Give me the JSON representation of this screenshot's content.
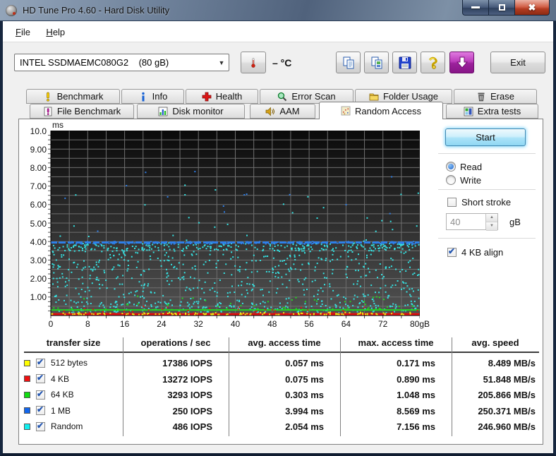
{
  "window": {
    "title": "HD Tune Pro 4.60 - Hard Disk Utility"
  },
  "menu": {
    "items": [
      {
        "label": "File"
      },
      {
        "label": "Help"
      }
    ]
  },
  "toolbar": {
    "drive_select": "INTEL SSDMAEMC080G2    (80 gB)",
    "temperature": "– °C",
    "exit_label": "Exit"
  },
  "tabs": {
    "row1": [
      {
        "label": "Benchmark"
      },
      {
        "label": "Info"
      },
      {
        "label": "Health"
      },
      {
        "label": "Error Scan"
      },
      {
        "label": "Folder Usage"
      },
      {
        "label": "Erase"
      }
    ],
    "row2": [
      {
        "label": "File Benchmark"
      },
      {
        "label": "Disk monitor"
      },
      {
        "label": "AAM"
      },
      {
        "label": "Random Access",
        "active": true
      },
      {
        "label": "Extra tests"
      }
    ]
  },
  "controls": {
    "start": "Start",
    "read": "Read",
    "write": "Write",
    "short_stroke": "Short stroke",
    "short_stroke_value": "40",
    "short_stroke_unit": "gB",
    "align": "4 KB align"
  },
  "chart_data": {
    "type": "scatter",
    "title": "Random Access benchmark — access time (ms) vs disk position (gB)",
    "ylabel_unit": "ms",
    "xlim": [
      0,
      80
    ],
    "ylim": [
      0,
      10
    ],
    "xtick_labels": [
      "0",
      "8",
      "16",
      "24",
      "32",
      "40",
      "48",
      "56",
      "64",
      "72",
      "80gB"
    ],
    "ytick_labels": [
      "10.0",
      "9.00",
      "8.00",
      "7.00",
      "6.00",
      "5.00",
      "4.00",
      "3.00",
      "2.00",
      "1.00"
    ],
    "grid": {
      "on": true,
      "x_step_gb": 4,
      "y_step_ms": 0.5,
      "color": "#6f6f6f"
    },
    "plot_bg": {
      "top": "#0a0a0a",
      "bottom": "#525252"
    },
    "series": [
      {
        "name": "Random",
        "color": "#35e4e4",
        "avg_ms": 2.054,
        "max_ms": 7.156,
        "render": {
          "points": [
            {
              "count": 640,
              "min": 0.18,
              "max": 3.85,
              "bias": 1
            },
            {
              "count": 210,
              "min": 3.45,
              "max": 3.93,
              "bias": 1
            },
            {
              "count": 140,
              "min": 0.05,
              "max": 0.75,
              "bias": 1.4
            },
            {
              "count": 30,
              "min": 4.0,
              "max": 7.16,
              "bias": 1.6
            }
          ]
        }
      },
      {
        "name": "1 MB",
        "color": "#2e7fe8",
        "avg_ms": 3.994,
        "max_ms": 8.569,
        "render": {
          "line_ms": 3.95,
          "line_w": 3,
          "dash": [
            9,
            3
          ],
          "points": [
            {
              "count": 170,
              "min": 3.86,
              "max": 4.0,
              "bias": 1
            },
            {
              "count": 14,
              "min": 4.3,
              "max": 8.57,
              "bias": 1
            }
          ]
        }
      },
      {
        "name": "64 KB",
        "color": "#22d622",
        "avg_ms": 0.303,
        "max_ms": 1.048,
        "render": {
          "line_ms": 0.3,
          "line_w": 2,
          "points": [
            {
              "count": 60,
              "min": 0.32,
              "max": 1.05,
              "bias": 2.6
            }
          ]
        }
      },
      {
        "name": "4 KB",
        "color": "#e01212",
        "avg_ms": 0.075,
        "max_ms": 0.89,
        "render": {
          "line_ms": 0.075,
          "line_w": 3,
          "points": [
            {
              "count": 80,
              "min": 0.09,
              "max": 0.5,
              "bias": 3
            }
          ]
        }
      },
      {
        "name": "512 bytes",
        "color": "#f0ee12",
        "avg_ms": 0.057,
        "max_ms": 0.171,
        "render": {
          "points": [
            {
              "count": 140,
              "min": 0.05,
              "max": 0.18,
              "bias": 2.2
            }
          ]
        }
      }
    ]
  },
  "table": {
    "headers": [
      "transfer size",
      "operations / sec",
      "avg. access time",
      "max. access time",
      "avg. speed"
    ],
    "rows": [
      {
        "label": "512 bytes",
        "color": "#ffff00",
        "checked": true,
        "ops": "17386 IOPS",
        "avg": "0.057 ms",
        "max": "0.171 ms",
        "speed": "8.489 MB/s"
      },
      {
        "label": "4 KB",
        "color": "#ee1111",
        "checked": true,
        "ops": "13272 IOPS",
        "avg": "0.075 ms",
        "max": "0.890 ms",
        "speed": "51.848 MB/s"
      },
      {
        "label": "64 KB",
        "color": "#11dd11",
        "checked": true,
        "ops": "3293 IOPS",
        "avg": "0.303 ms",
        "max": "1.048 ms",
        "speed": "205.866 MB/s"
      },
      {
        "label": "1 MB",
        "color": "#1166ee",
        "checked": true,
        "ops": "250 IOPS",
        "avg": "3.994 ms",
        "max": "8.569 ms",
        "speed": "250.371 MB/s"
      },
      {
        "label": "Random",
        "color": "#11eeee",
        "checked": true,
        "ops": "486 IOPS",
        "avg": "2.054 ms",
        "max": "7.156 ms",
        "speed": "246.960 MB/s"
      }
    ]
  }
}
